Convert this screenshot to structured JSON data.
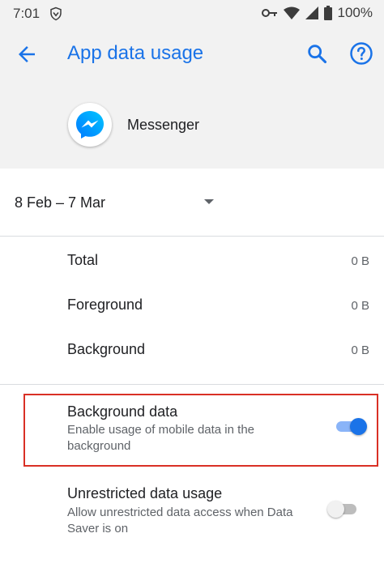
{
  "status_bar": {
    "time": "7:01",
    "battery": "100%"
  },
  "header": {
    "title": "App data usage"
  },
  "app": {
    "name": "Messenger"
  },
  "date_range": {
    "label": "8 Feb – 7 Mar"
  },
  "usage": [
    {
      "label": "Total",
      "value": "0 B"
    },
    {
      "label": "Foreground",
      "value": "0 B"
    },
    {
      "label": "Background",
      "value": "0 B"
    }
  ],
  "settings": {
    "background_data": {
      "title": "Background data",
      "subtitle": "Enable usage of mobile data in the background",
      "enabled": true
    },
    "unrestricted_data": {
      "title": "Unrestricted data usage",
      "subtitle": "Allow unrestricted data access when Data Saver is on",
      "enabled": false
    }
  },
  "colors": {
    "accent": "#1a73e8",
    "highlight_border": "#d93025"
  }
}
